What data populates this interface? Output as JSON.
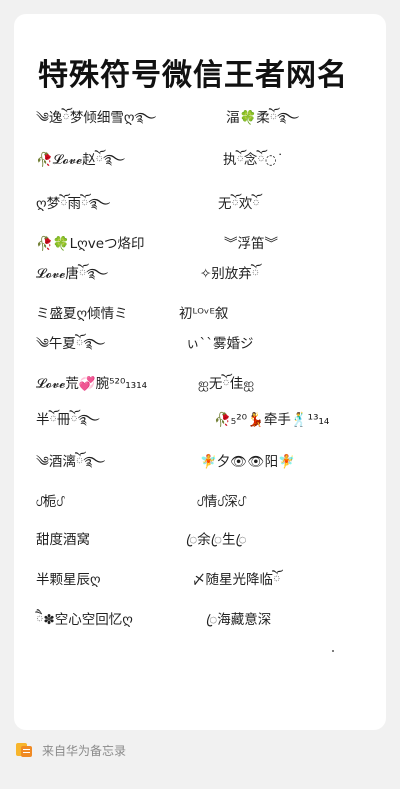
{
  "note": {
    "title": "特殊符号微信王者网名"
  },
  "names": [
    "༄逸ོ梦倾细雪ღ࿐",
    "湢🍀柔ོ࿐",
    "🥀𝓛𝓸𝓿𝓮赵ོ࿐",
    "执ོ念ོ◌ ͘",
    "ღ梦ོ雨ོ࿐",
    "无ོ欢ོ",
    "🥀🍀Lღveつ烙印",
    "︾浮笛︾",
    "𝓛𝓸𝓿𝓮唐ོ࿐",
    "✧别放弃ོ",
    "ミ盛夏ღ倾情ミ",
    "初ᴸᴼᵛᴱ叙",
    "༄午夏ོ࿐",
    "ぃ``雾婚ジ",
    "𝓛𝓸𝓿𝓮荒💞腕⁵²⁰₁₃₁₄",
    "ஐ无ོ佳ஐ",
    "半ོ冊ོ࿐",
    "🥀₅²⁰💃牵手🕺¹³₁₄",
    "༄酒漓ོ࿐",
    "🧚夕👁👁阳🧚",
    "ᦔ栀ᦔ",
    "ᦔ情ᦔ深ᦔ",
    "甜度酒窝",
    "ꦿ余ꦿ生ꦿ",
    "半颗星辰ღ",
    "〆随星光降临ོ",
    "ཻ✽空心空回忆ღ",
    "ꦿ海藏意深"
  ],
  "footer": {
    "source": "来自华为备忘录",
    "icon": "memo-app-icon",
    "accent_colors": [
      "#f7b52c",
      "#f08a24"
    ]
  }
}
